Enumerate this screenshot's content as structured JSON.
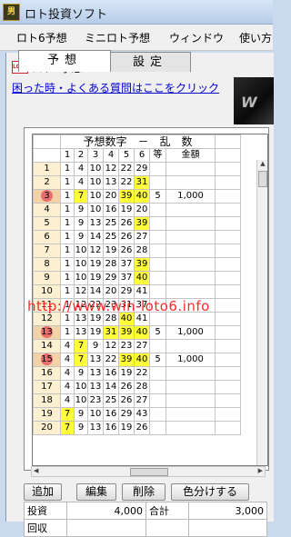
{
  "window": {
    "title": "ロト投資ソフト",
    "icon": "男"
  },
  "menu": [
    "ロト6予想",
    "ミニロト予想",
    "ウィンドウ",
    "使い方"
  ],
  "child": {
    "title": "ロト6予想",
    "icon": "LOTO6"
  },
  "help_link": "困った時・よくある質問はここをクリック",
  "banner_text": "W",
  "tabs": [
    "予想",
    "設定"
  ],
  "grid": {
    "title": "予想数字　－　乱　数",
    "headers": [
      "1",
      "2",
      "3",
      "4",
      "5",
      "6",
      "等",
      "金額"
    ],
    "rows": [
      {
        "no": "1",
        "nums": [
          "1",
          "4",
          "10",
          "12",
          "22",
          "29"
        ],
        "hl": [],
        "rank": "",
        "amount": ""
      },
      {
        "no": "2",
        "nums": [
          "1",
          "4",
          "10",
          "13",
          "22",
          "31"
        ],
        "hl": [
          5
        ],
        "rank": "",
        "amount": ""
      },
      {
        "no": "3",
        "nums": [
          "1",
          "7",
          "10",
          "20",
          "39",
          "40"
        ],
        "hl": [
          1,
          4,
          5
        ],
        "rank": "5",
        "amount": "1,000",
        "mark": true
      },
      {
        "no": "4",
        "nums": [
          "1",
          "9",
          "10",
          "16",
          "19",
          "20"
        ],
        "hl": [],
        "rank": "",
        "amount": ""
      },
      {
        "no": "5",
        "nums": [
          "1",
          "9",
          "13",
          "25",
          "26",
          "39"
        ],
        "hl": [
          5
        ],
        "rank": "",
        "amount": ""
      },
      {
        "no": "6",
        "nums": [
          "1",
          "9",
          "14",
          "25",
          "26",
          "27"
        ],
        "hl": [],
        "rank": "",
        "amount": ""
      },
      {
        "no": "7",
        "nums": [
          "1",
          "10",
          "12",
          "19",
          "26",
          "28"
        ],
        "hl": [],
        "rank": "",
        "amount": ""
      },
      {
        "no": "8",
        "nums": [
          "1",
          "10",
          "19",
          "28",
          "37",
          "39"
        ],
        "hl": [
          5
        ],
        "rank": "",
        "amount": ""
      },
      {
        "no": "9",
        "nums": [
          "1",
          "10",
          "19",
          "29",
          "37",
          "40"
        ],
        "hl": [
          5
        ],
        "rank": "",
        "amount": ""
      },
      {
        "no": "10",
        "nums": [
          "1",
          "12",
          "14",
          "20",
          "29",
          "41"
        ],
        "hl": [],
        "rank": "",
        "amount": ""
      },
      {
        "no": "11",
        "nums": [
          "1",
          "12",
          "22",
          "23",
          "31",
          "37"
        ],
        "hl": [],
        "rank": "",
        "amount": ""
      },
      {
        "no": "12",
        "nums": [
          "1",
          "13",
          "19",
          "28",
          "40",
          "41"
        ],
        "hl": [
          4
        ],
        "rank": "",
        "amount": ""
      },
      {
        "no": "13",
        "nums": [
          "1",
          "13",
          "19",
          "31",
          "39",
          "40"
        ],
        "hl": [
          3,
          4,
          5
        ],
        "rank": "5",
        "amount": "1,000",
        "mark": true
      },
      {
        "no": "14",
        "nums": [
          "4",
          "7",
          "9",
          "12",
          "23",
          "27"
        ],
        "hl": [
          1
        ],
        "rank": "",
        "amount": ""
      },
      {
        "no": "15",
        "nums": [
          "4",
          "7",
          "13",
          "22",
          "39",
          "40"
        ],
        "hl": [
          1,
          4,
          5
        ],
        "rank": "5",
        "amount": "1,000",
        "mark": true
      },
      {
        "no": "16",
        "nums": [
          "4",
          "9",
          "13",
          "16",
          "19",
          "22"
        ],
        "hl": [],
        "rank": "",
        "amount": ""
      },
      {
        "no": "17",
        "nums": [
          "4",
          "10",
          "13",
          "14",
          "26",
          "28"
        ],
        "hl": [],
        "rank": "",
        "amount": ""
      },
      {
        "no": "18",
        "nums": [
          "4",
          "10",
          "23",
          "25",
          "26",
          "27"
        ],
        "hl": [],
        "rank": "",
        "amount": ""
      },
      {
        "no": "19",
        "nums": [
          "7",
          "9",
          "10",
          "16",
          "29",
          "43"
        ],
        "hl": [
          0
        ],
        "rank": "",
        "amount": ""
      },
      {
        "no": "20",
        "nums": [
          "7",
          "9",
          "13",
          "16",
          "19",
          "26"
        ],
        "hl": [
          0
        ],
        "rank": "",
        "amount": ""
      }
    ]
  },
  "watermark": "http://www.win-loto6.info",
  "buttons": [
    "追加",
    "編集",
    "削除",
    "色分けする"
  ],
  "summary": {
    "label1": "投資",
    "value1": "4,000",
    "label2": "合計",
    "value2": "3,000",
    "label3": "回収"
  }
}
